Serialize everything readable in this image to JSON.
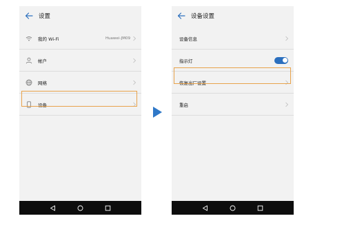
{
  "colors": {
    "accent": "#2b6fbe",
    "highlight": "#e8a24a",
    "navbar": "#0d0d0d",
    "screen_bg": "#f2f2f2",
    "step_arrow": "#2f78c8"
  },
  "left_screen": {
    "title": "设置",
    "items": [
      {
        "icon": "wifi-icon",
        "label": "我的 Wi-Fi",
        "value": "Huawei-JM09"
      },
      {
        "icon": "account-icon",
        "label": "帐户"
      },
      {
        "icon": "globe-icon",
        "label": "网络"
      },
      {
        "icon": "device-icon",
        "label": "设备",
        "highlighted": true
      }
    ]
  },
  "right_screen": {
    "title": "设备设置",
    "items": [
      {
        "label": "设备信息"
      },
      {
        "label": "指示灯",
        "toggle": true
      },
      {
        "label": "恢复出厂设置",
        "highlighted": true
      },
      {
        "label": "重启"
      }
    ]
  },
  "navbar": {
    "buttons": [
      "back-triangle-icon",
      "home-circle-icon",
      "recents-square-icon"
    ]
  }
}
